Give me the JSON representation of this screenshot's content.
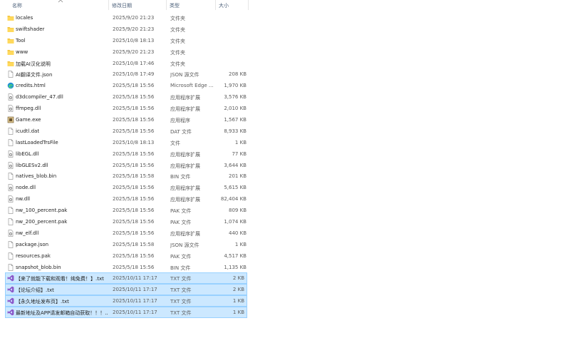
{
  "columns": {
    "name": "名称",
    "date": "修改日期",
    "type": "类型",
    "size": "大小"
  },
  "files": [
    {
      "name": "locales",
      "date": "2025/9/20 21:23",
      "type": "文件夹",
      "size": "",
      "icon": "folder-icon",
      "selected": false
    },
    {
      "name": "swiftshader",
      "date": "2025/9/20 21:23",
      "type": "文件夹",
      "size": "",
      "icon": "folder-icon",
      "selected": false
    },
    {
      "name": "Tool",
      "date": "2025/10/8 18:13",
      "type": "文件夹",
      "size": "",
      "icon": "folder-icon",
      "selected": false
    },
    {
      "name": "www",
      "date": "2025/9/20 21:23",
      "type": "文件夹",
      "size": "",
      "icon": "folder-icon",
      "selected": false
    },
    {
      "name": "加载AI汉化说明",
      "date": "2025/10/8 17:46",
      "type": "文件夹",
      "size": "",
      "icon": "folder-icon",
      "selected": false
    },
    {
      "name": "AI翻译文件.json",
      "date": "2025/10/8 17:49",
      "type": "JSON 源文件",
      "size": "208 KB",
      "icon": "document-icon",
      "selected": false
    },
    {
      "name": "credits.html",
      "date": "2025/5/18 15:56",
      "type": "Microsoft Edge ...",
      "size": "1,970 KB",
      "icon": "edge-icon",
      "selected": false
    },
    {
      "name": "d3dcompiler_47.dll",
      "date": "2025/5/18 15:56",
      "type": "应用程序扩展",
      "size": "3,576 KB",
      "icon": "dll-icon",
      "selected": false
    },
    {
      "name": "ffmpeg.dll",
      "date": "2025/5/18 15:56",
      "type": "应用程序扩展",
      "size": "2,010 KB",
      "icon": "dll-icon",
      "selected": false
    },
    {
      "name": "Game.exe",
      "date": "2025/5/18 15:56",
      "type": "应用程序",
      "size": "1,567 KB",
      "icon": "game-exe-icon",
      "selected": false
    },
    {
      "name": "icudtl.dat",
      "date": "2025/5/18 15:56",
      "type": "DAT 文件",
      "size": "8,933 KB",
      "icon": "document-icon",
      "selected": false
    },
    {
      "name": "lastLoadedTrsFile",
      "date": "2025/10/8 18:13",
      "type": "文件",
      "size": "1 KB",
      "icon": "document-icon",
      "selected": false
    },
    {
      "name": "libEGL.dll",
      "date": "2025/5/18 15:56",
      "type": "应用程序扩展",
      "size": "77 KB",
      "icon": "dll-icon",
      "selected": false
    },
    {
      "name": "libGLESv2.dll",
      "date": "2025/5/18 15:56",
      "type": "应用程序扩展",
      "size": "3,644 KB",
      "icon": "dll-icon",
      "selected": false
    },
    {
      "name": "natives_blob.bin",
      "date": "2025/5/18 15:58",
      "type": "BIN 文件",
      "size": "201 KB",
      "icon": "document-icon",
      "selected": false
    },
    {
      "name": "node.dll",
      "date": "2025/5/18 15:56",
      "type": "应用程序扩展",
      "size": "5,615 KB",
      "icon": "dll-icon",
      "selected": false
    },
    {
      "name": "nw.dll",
      "date": "2025/5/18 15:56",
      "type": "应用程序扩展",
      "size": "82,404 KB",
      "icon": "dll-icon",
      "selected": false
    },
    {
      "name": "nw_100_percent.pak",
      "date": "2025/5/18 15:56",
      "type": "PAK 文件",
      "size": "809 KB",
      "icon": "document-icon",
      "selected": false
    },
    {
      "name": "nw_200_percent.pak",
      "date": "2025/5/18 15:56",
      "type": "PAK 文件",
      "size": "1,074 KB",
      "icon": "document-icon",
      "selected": false
    },
    {
      "name": "nw_elf.dll",
      "date": "2025/5/18 15:56",
      "type": "应用程序扩展",
      "size": "440 KB",
      "icon": "dll-icon",
      "selected": false
    },
    {
      "name": "package.json",
      "date": "2025/5/18 15:58",
      "type": "JSON 源文件",
      "size": "1 KB",
      "icon": "document-icon",
      "selected": false
    },
    {
      "name": "resources.pak",
      "date": "2025/5/18 15:56",
      "type": "PAK 文件",
      "size": "4,517 KB",
      "icon": "document-icon",
      "selected": false
    },
    {
      "name": "snapshot_blob.bin",
      "date": "2025/5/18 15:56",
      "type": "BIN 文件",
      "size": "1,135 KB",
      "icon": "document-icon",
      "selected": false
    },
    {
      "name": "【来了就能下载和观看！纯免费！】.txt",
      "date": "2025/10/11 17:17",
      "type": "TXT 文件",
      "size": "2 KB",
      "icon": "visual-studio-icon",
      "selected": true
    },
    {
      "name": "【论坛介绍】.txt",
      "date": "2025/10/11 17:17",
      "type": "TXT 文件",
      "size": "2 KB",
      "icon": "visual-studio-icon",
      "selected": true
    },
    {
      "name": "【永久地址发布页】.txt",
      "date": "2025/10/11 17:17",
      "type": "TXT 文件",
      "size": "1 KB",
      "icon": "visual-studio-icon",
      "selected": true
    },
    {
      "name": "最新地址及APP请发邮箱自动获取！！！...",
      "date": "2025/10/11 17:17",
      "type": "TXT 文件",
      "size": "1 KB",
      "icon": "visual-studio-icon",
      "selected": true
    }
  ],
  "colors": {
    "selection": "#cce8ff",
    "selection_border": "#99d1ff",
    "folder": "#f3c43d",
    "header_text": "#4c607a"
  }
}
